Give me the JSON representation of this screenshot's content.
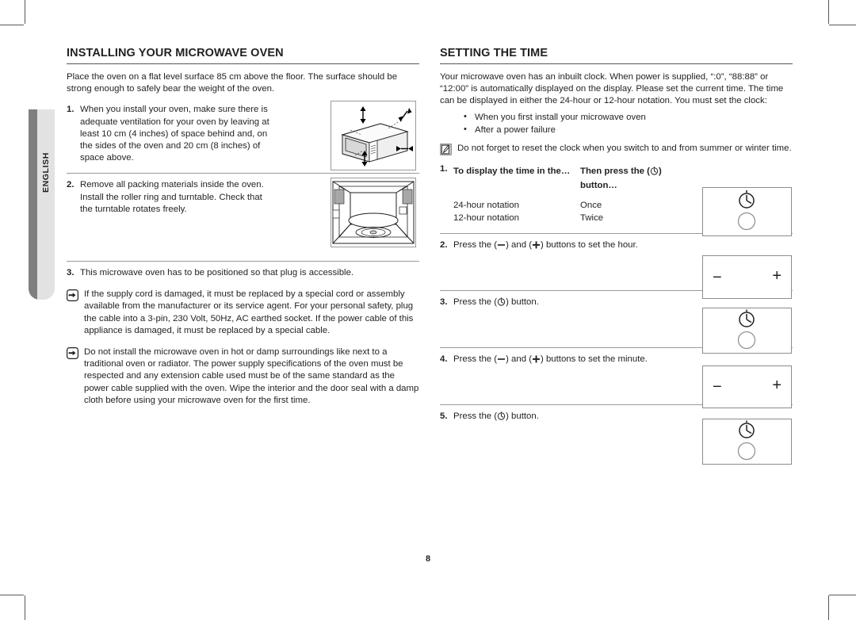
{
  "page": {
    "number": "8",
    "side_tab": "ENGLISH"
  },
  "left": {
    "title": "INSTALLING YOUR MICROWAVE OVEN",
    "intro": "Place the oven on a flat level surface 85 cm above the floor. The surface should be strong enough to safely bear the weight of the oven.",
    "steps": [
      {
        "num": "1.",
        "text": "When you install your oven, make sure there is adequate ventilation for your oven by leaving at least 10 cm (4 inches) of space behind and, on the sides of the oven and 20 cm (8 inches) of space above.",
        "figure": "oven-clearance-diagram"
      },
      {
        "num": "2.",
        "text": "Remove all packing materials inside the oven. Install the roller ring and turntable. Check that the turntable rotates freely.",
        "figure": "oven-cavity-turntable-diagram"
      },
      {
        "num": "3.",
        "text": "This microwave oven has to be positioned so that plug is accessible.",
        "figure": ""
      }
    ],
    "notes": [
      {
        "icon": "pointing-hand-icon",
        "text": "If the supply cord is damaged, it must be replaced by a special cord or assembly available from the manufacturer or its service agent. For your personal safety, plug the cable into a 3-pin, 230 Volt, 50Hz, AC earthed socket. If the power cable of this appliance is damaged, it must be replaced by a special cable."
      },
      {
        "icon": "pointing-hand-icon",
        "text": "Do not install the microwave oven in hot or damp surroundings like next to a traditional oven or radiator. The power supply specifications of the oven must be respected and any extension cable used must be of the same standard as the power cable supplied with the oven. Wipe the interior and the door seal with a damp cloth before using your microwave oven for the first time."
      }
    ]
  },
  "right": {
    "title": "SETTING THE TIME",
    "intro": "Your microwave oven has an inbuilt clock. When power is supplied, “:0”, “88:88” or “12:00” is automatically displayed on the display. Please set the current time. The time can be displayed in either the 24-hour or 12-hour notation. You must set the clock:",
    "bullets": [
      "When you first install your microwave oven",
      "After a power failure"
    ],
    "note": {
      "icon": "note-pencil-icon",
      "text": "Do not forget to reset the clock when you switch to and from summer or winter time."
    },
    "steps": [
      {
        "num": "1.",
        "text": "",
        "col_a_heading": "To display the time in the…",
        "col_b_heading": "Then press the (⏲) button…",
        "col_b_heading_prefix": "Then press the (",
        "col_b_heading_suffix": ") button…",
        "rows": [
          {
            "a": "24-hour notation",
            "b": "Once"
          },
          {
            "a": "12-hour notation",
            "b": "Twice"
          }
        ],
        "panel": "clock-button-panel"
      },
      {
        "num": "2.",
        "text_before": "Press the (",
        "text_mid": ") and (",
        "text_after": ") buttons to set the hour.",
        "text": "Press the (—) and (+) buttons to set the hour.",
        "panel": "minus-plus-panel",
        "panel_minus": "−",
        "panel_plus": "+"
      },
      {
        "num": "3.",
        "text_before": "Press the (",
        "text_after": ") button.",
        "text": "Press the (⏲) button.",
        "panel": "clock-button-panel"
      },
      {
        "num": "4.",
        "text_before": "Press the (",
        "text_mid": ") and (",
        "text_after": ") buttons to set the minute.",
        "text": "Press the (—) and (+) buttons to set the minute.",
        "panel": "minus-plus-panel",
        "panel_minus": "−",
        "panel_plus": "+"
      },
      {
        "num": "5.",
        "text_before": "Press the (",
        "text_after": ") button.",
        "text": "Press the (⏲) button.",
        "panel": "clock-button-panel"
      }
    ]
  },
  "colors": {
    "text": "#231f20",
    "rule": "#9a9a9a",
    "title_rule": "#58585a",
    "tab_spine": "#7f7f7f",
    "tab_bg": "#e2e2e2"
  }
}
